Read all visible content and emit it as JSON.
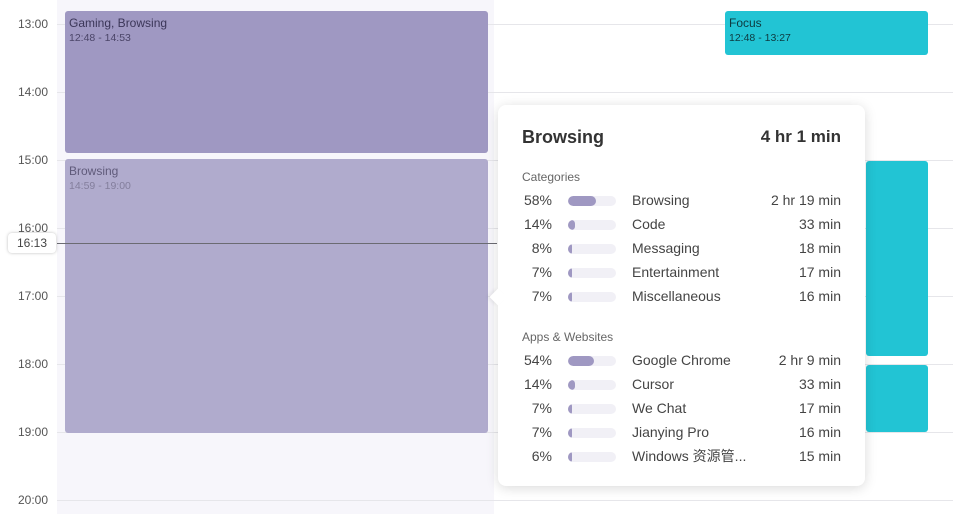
{
  "timeline": {
    "hours": [
      "13:00",
      "14:00",
      "15:00",
      "16:00",
      "17:00",
      "18:00",
      "19:00",
      "20:00"
    ],
    "current_time": "16:13"
  },
  "events": {
    "gaming": {
      "title": "Gaming, Browsing",
      "time": "12:48 - 14:53",
      "color": "#9f98c2"
    },
    "browsing": {
      "title": "Browsing",
      "time": "14:59 - 19:00",
      "color": "#b0abcd"
    },
    "focus": {
      "title": "Focus",
      "time": "12:48 - 13:27",
      "color": "#22c4d4"
    }
  },
  "popover": {
    "title": "Browsing",
    "total": "4 hr 1 min",
    "categories_title": "Categories",
    "categories": [
      {
        "pct": "58%",
        "ratio": 0.58,
        "name": "Browsing",
        "duration": "2 hr 19 min"
      },
      {
        "pct": "14%",
        "ratio": 0.14,
        "name": "Code",
        "duration": "33 min"
      },
      {
        "pct": "8%",
        "ratio": 0.08,
        "name": "Messaging",
        "duration": "18 min"
      },
      {
        "pct": "7%",
        "ratio": 0.07,
        "name": "Entertainment",
        "duration": "17 min"
      },
      {
        "pct": "7%",
        "ratio": 0.07,
        "name": "Miscellaneous",
        "duration": "16 min"
      }
    ],
    "apps_title": "Apps & Websites",
    "apps": [
      {
        "pct": "54%",
        "ratio": 0.54,
        "name": "Google Chrome",
        "duration": "2 hr 9 min"
      },
      {
        "pct": "14%",
        "ratio": 0.14,
        "name": "Cursor",
        "duration": "33 min"
      },
      {
        "pct": "7%",
        "ratio": 0.07,
        "name": "We Chat",
        "duration": "17 min"
      },
      {
        "pct": "7%",
        "ratio": 0.07,
        "name": "Jianying Pro",
        "duration": "16 min"
      },
      {
        "pct": "6%",
        "ratio": 0.06,
        "name": "Windows 资源管...",
        "duration": "15 min"
      }
    ]
  }
}
